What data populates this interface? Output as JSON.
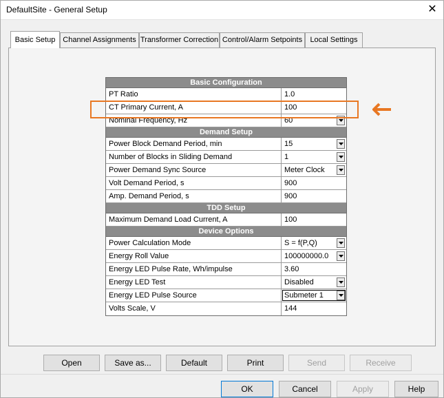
{
  "window": {
    "title": "DefaultSite - General Setup",
    "close_glyph": "✕"
  },
  "tabs": [
    {
      "label": "Basic Setup",
      "active": true
    },
    {
      "label": "Channel Assignments"
    },
    {
      "label": "Transformer Correction"
    },
    {
      "label": "Control/Alarm Setpoints"
    },
    {
      "label": "Local Settings"
    }
  ],
  "sections": {
    "basic": "Basic Configuration",
    "demand": "Demand Setup",
    "tdd": "TDD Setup",
    "device": "Device Options"
  },
  "rows": {
    "pt_ratio": {
      "label": "PT Ratio",
      "value": "1.0"
    },
    "ct_primary": {
      "label": "CT Primary Current, A",
      "value": "100"
    },
    "nominal_freq": {
      "label": "Nominal Frequency, Hz",
      "value": "60"
    },
    "power_block": {
      "label": "Power Block Demand Period, min",
      "value": "15"
    },
    "num_blocks": {
      "label": "Number of Blocks in Sliding Demand",
      "value": "1"
    },
    "sync_source": {
      "label": "Power Demand Sync Source",
      "value": "Meter Clock"
    },
    "volt_demand": {
      "label": "Volt Demand Period, s",
      "value": "900"
    },
    "amp_demand": {
      "label": "Amp. Demand Period, s",
      "value": "900"
    },
    "max_demand": {
      "label": "Maximum Demand Load Current, A",
      "value": "100"
    },
    "power_calc": {
      "label": "Power Calculation Mode",
      "value": "S = f(P,Q)"
    },
    "energy_roll": {
      "label": "Energy Roll Value",
      "value": "100000000.0"
    },
    "led_rate": {
      "label": "Energy LED Pulse Rate, Wh/impulse",
      "value": "3.60"
    },
    "led_test": {
      "label": "Energy LED Test",
      "value": "Disabled"
    },
    "led_source": {
      "label": "Energy LED Pulse Source",
      "value": "Submeter 1"
    },
    "volts_scale": {
      "label": "Volts Scale, V",
      "value": "144"
    }
  },
  "actions": {
    "open": "Open",
    "save_as": "Save as...",
    "default": "Default",
    "print": "Print",
    "send": "Send",
    "receive": "Receive"
  },
  "footer": {
    "ok": "OK",
    "cancel": "Cancel",
    "apply": "Apply",
    "help": "Help"
  },
  "colors": {
    "highlight": "#e87722",
    "section_header": "#8c8c8c",
    "focus_border": "#0078d7"
  },
  "icons": {
    "dropdown": "chevron-down-icon",
    "annotation": "arrow-left-icon"
  }
}
